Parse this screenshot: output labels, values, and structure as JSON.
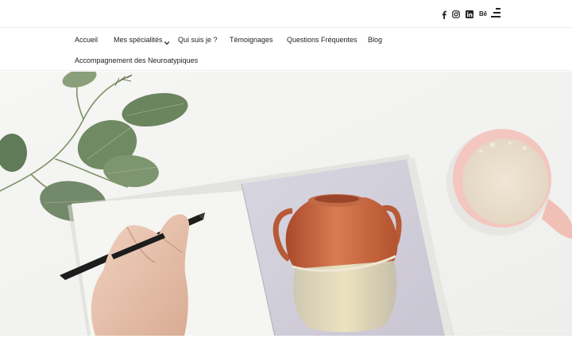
{
  "social_links": [
    {
      "icon": "facebook-icon"
    },
    {
      "icon": "instagram-icon"
    },
    {
      "icon": "linkedin-icon"
    },
    {
      "icon": "behance-icon",
      "label": "Bē"
    }
  ],
  "menu_toggle_icon": "hamburger-menu-icon",
  "nav": {
    "items": [
      {
        "label": "Accueil"
      },
      {
        "label": "Mes spécialités",
        "has_dropdown": true,
        "dropdown_icon": "chevron-down-icon"
      },
      {
        "label": "Qui suis je ?"
      },
      {
        "label": "Témoignages"
      },
      {
        "label": "Questions Fréquentes"
      },
      {
        "label": "Blog"
      },
      {
        "label": "Accompagnement des Neuroatypiques"
      }
    ]
  },
  "colors": {
    "background": "#ffffff",
    "text": "#222222",
    "divider": "#ececec",
    "hero_desk": "#f2f2f0",
    "cup": "#f4c9c3",
    "jar_terracotta": "#c96a45"
  }
}
